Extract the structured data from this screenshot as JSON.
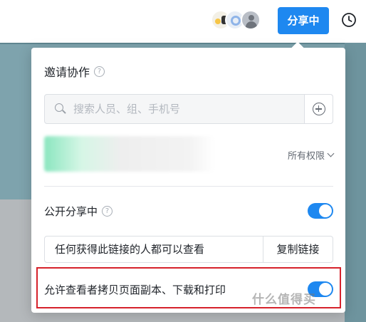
{
  "header": {
    "share_button": "分享中",
    "icons": {
      "history": "history-clock-icon"
    },
    "colors": {
      "accent": "#1e88f0"
    }
  },
  "panel": {
    "title": "邀请协作",
    "search": {
      "placeholder": "搜索人员、组、手机号",
      "value": ""
    },
    "member": {
      "permission": "所有权限"
    },
    "public_share": {
      "label": "公开分享中",
      "enabled": true
    },
    "link": {
      "text": "任何获得此链接的人都可以查看",
      "copy_button": "复制链接"
    },
    "allow_copy": {
      "label": "允许查看者拷贝页面副本、下载和打印",
      "enabled": true
    }
  },
  "highlight": {
    "color": "#d6222b"
  },
  "watermark": "什么值得买"
}
